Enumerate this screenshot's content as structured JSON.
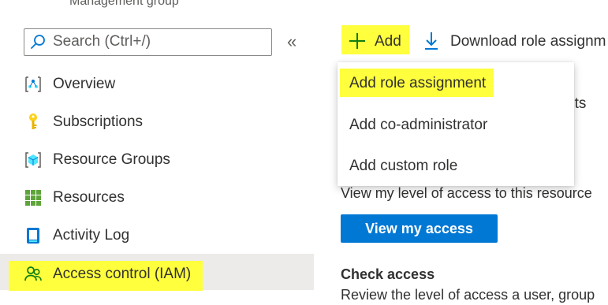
{
  "header": {
    "subtitle": "Management group"
  },
  "search": {
    "placeholder": "Search (Ctrl+/)",
    "collapse_glyph": "«"
  },
  "sidebar": {
    "items": [
      {
        "label": "Overview",
        "icon": "overview-icon"
      },
      {
        "label": "Subscriptions",
        "icon": "key-icon"
      },
      {
        "label": "Resource Groups",
        "icon": "resource-group-icon"
      },
      {
        "label": "Resources",
        "icon": "grid-icon"
      },
      {
        "label": "Activity Log",
        "icon": "activity-log-icon"
      },
      {
        "label": "Access control (IAM)",
        "icon": "users-icon",
        "selected": true
      }
    ]
  },
  "toolbar": {
    "add_label": "Add",
    "download_label": "Download role assignm"
  },
  "dropdown": {
    "items": [
      "Add role assignment",
      "Add co-administrator",
      "Add custom role"
    ]
  },
  "main": {
    "hidden_fragment": "nts",
    "view_desc": "View my level of access to this resource",
    "view_button": "View my access",
    "check_title": "Check access",
    "check_desc": "Review the level of access a user, group"
  },
  "colors": {
    "highlight": "#ffff3d",
    "accent": "#0078d4",
    "selected_bg": "#edebe9",
    "iam_icon": "#107c10"
  }
}
